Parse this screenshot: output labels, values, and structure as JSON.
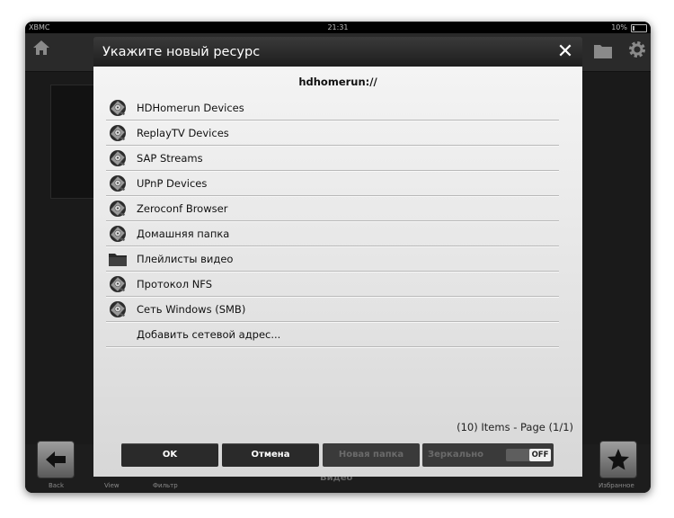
{
  "status_bar": {
    "carrier": "XBMC",
    "time": "21:31",
    "battery": "10%"
  },
  "background": {
    "bottom_labels": {
      "back": "Back",
      "view": "View",
      "filter": "Фильтр",
      "favorites": "Избранное"
    },
    "center_label": "Видео"
  },
  "dialog": {
    "title": "Укажите новый ресурс",
    "path": "hdhomerun://",
    "items": [
      {
        "label": "HDHomerun Devices",
        "icon": "network-drive-icon"
      },
      {
        "label": "ReplayTV Devices",
        "icon": "network-drive-icon"
      },
      {
        "label": "SAP Streams",
        "icon": "network-drive-icon"
      },
      {
        "label": "UPnP Devices",
        "icon": "network-drive-icon"
      },
      {
        "label": "Zeroconf Browser",
        "icon": "network-drive-icon"
      },
      {
        "label": "Домашняя папка",
        "icon": "network-drive-icon"
      },
      {
        "label": "Плейлисты видео",
        "icon": "folder-icon"
      },
      {
        "label": "Протокол NFS",
        "icon": "network-drive-icon"
      },
      {
        "label": "Сеть Windows (SMB)",
        "icon": "network-drive-icon"
      },
      {
        "label": "Добавить сетевой адрес...",
        "icon": ""
      }
    ],
    "pager": "(10) Items - Page (1/1)",
    "buttons": {
      "ok": "OK",
      "cancel": "Отмена",
      "new_folder": "Новая папка",
      "mirror": "Зеркально"
    },
    "mirror_toggle": "OFF"
  },
  "colors": {
    "dialog_header": "#2b2b2b",
    "dialog_body": "#e6e6e6",
    "button_dark": "#2a2a2a",
    "button_disabled_text": "#6a6a6a"
  }
}
